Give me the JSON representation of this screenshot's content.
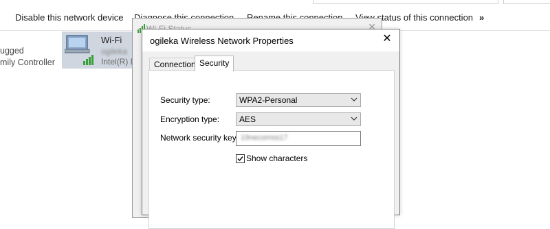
{
  "command_bar": {
    "disable_label": "Disable this network device",
    "diagnose_label": "Diagnose this connection",
    "rename_label": "Rename this connection",
    "view_status_label": "View status of this connection",
    "more_label": "»"
  },
  "left_panel": {
    "line1": "ugged",
    "line2": "mily Controller"
  },
  "adapter": {
    "name": "Wi-Fi",
    "ssid": "ogileka",
    "description": "Intel(R) D",
    "icon": "network-adapter-icon"
  },
  "status_window": {
    "title": "Wi-Fi Status",
    "close_glyph": "✕"
  },
  "dialog": {
    "title": "ogileka Wireless Network Properties",
    "close_glyph": "✕",
    "tabs": [
      {
        "label": "Connection",
        "active": false
      },
      {
        "label": "Security",
        "active": true
      }
    ],
    "security": {
      "security_type_label": "Security type:",
      "security_type_value": "WPA2-Personal",
      "encryption_type_label": "Encryption type:",
      "encryption_type_value": "AES",
      "key_label": "Network security key",
      "key_value": "19necomss17",
      "show_characters_label": "Show characters",
      "show_characters_checked": true
    }
  },
  "colors": {
    "adapter_tile": "#cfd6df",
    "dialog_bg": "#f0f0f0",
    "wifi_bars": "#3aa03a"
  }
}
